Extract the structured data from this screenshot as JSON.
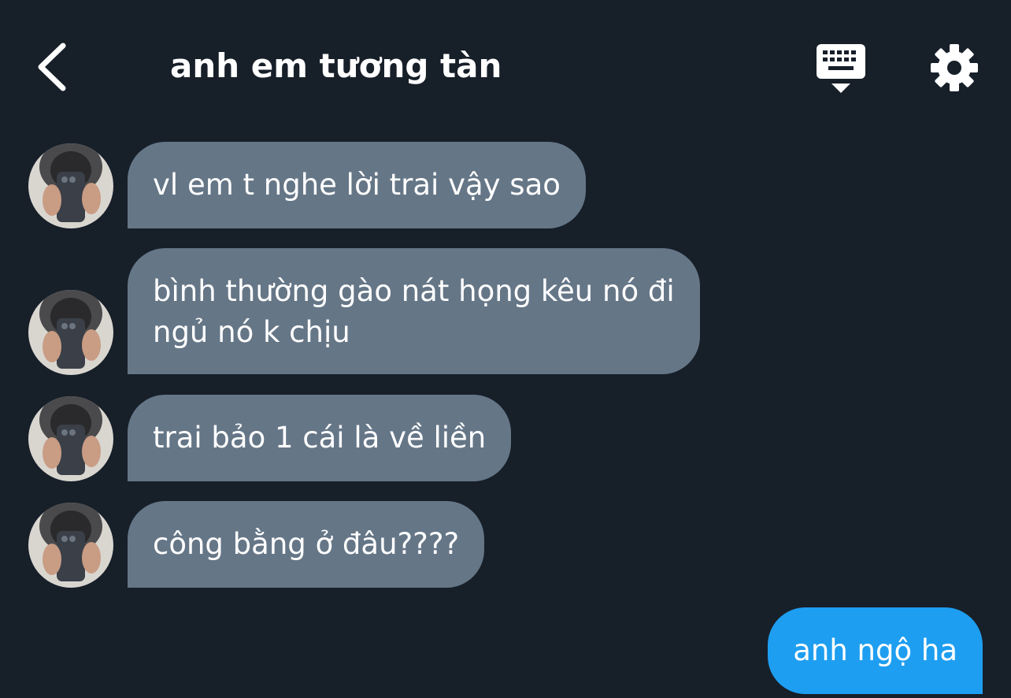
{
  "header": {
    "title": "anh em tương tàn",
    "back_icon": "chevron-left-icon",
    "keyboard_icon": "keyboard-icon",
    "settings_icon": "gear-icon"
  },
  "colors": {
    "background": "#171f29",
    "incoming_bubble": "#657687",
    "outgoing_bubble": "#1e9ef0",
    "text": "#ffffff"
  },
  "messages": [
    {
      "direction": "incoming",
      "text": "vl em t nghe lời trai vậy sao"
    },
    {
      "direction": "incoming",
      "text": "bình thường gào nát họng kêu nó đi\nngủ nó k chịu"
    },
    {
      "direction": "incoming",
      "text": "trai bảo 1 cái là về liền"
    },
    {
      "direction": "incoming",
      "text": "công bằng ở đâu????"
    },
    {
      "direction": "outgoing",
      "text": "anh ngộ ha"
    }
  ]
}
